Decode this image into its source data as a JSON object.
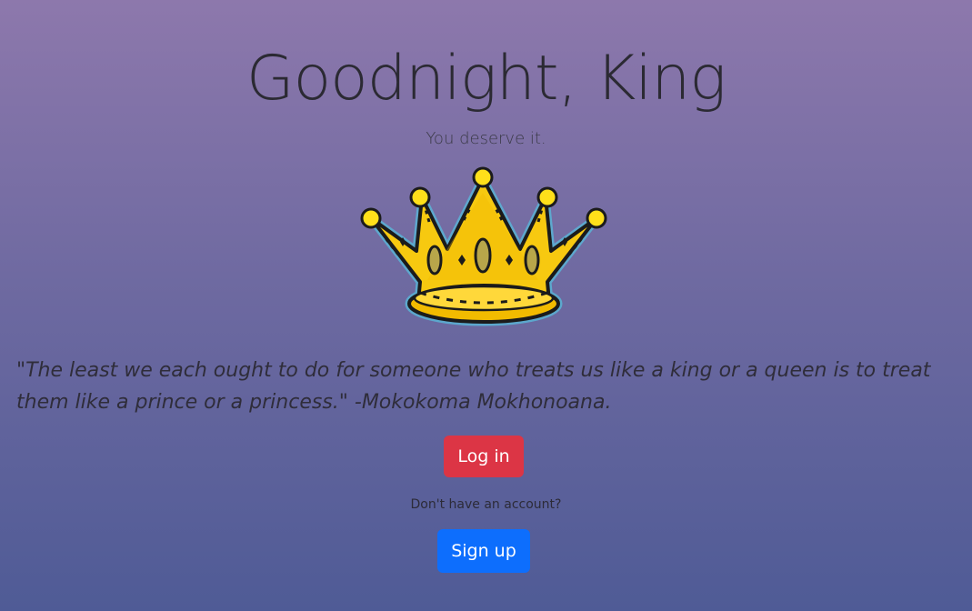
{
  "header": {
    "title": "Goodnight, King",
    "subtitle": "You deserve it."
  },
  "hero_image": {
    "icon": "crown-icon",
    "colors": {
      "gold": "#f7c910",
      "outline": "#1b1b1b",
      "glow": "#4da3c9"
    }
  },
  "quote": {
    "text": "\"The least we each ought to do for someone who treats us like a king or a queen is to treat them like a prince or a princess.\" -Mokokoma Mokhonoana."
  },
  "auth": {
    "login_label": "Log in",
    "login_color": "#dc3545",
    "no_account_text": "Don't have an account?",
    "signup_label": "Sign up",
    "signup_color": "#0d6efd"
  }
}
